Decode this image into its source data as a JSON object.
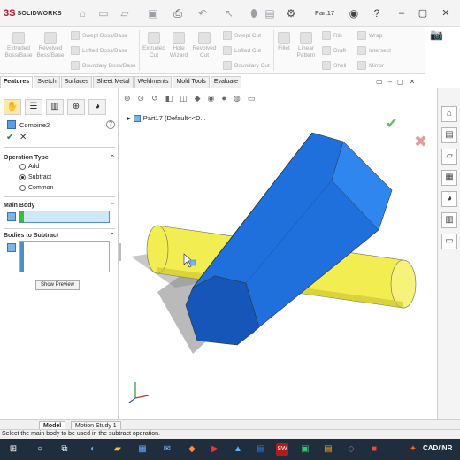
{
  "app": {
    "logo_text": "SOLIDWORKS",
    "doc_title": "Part17"
  },
  "ribbon": {
    "extruded_boss": "Extruded\nBoss/Base",
    "revolved_boss": "Revolved\nBoss/Base",
    "swept_boss": "Swept Boss/Base",
    "lofted_boss": "Lofted Boss/Base",
    "boundary_boss": "Boundary Boss/Base",
    "extruded_cut": "Extruded\nCut",
    "hole_wizard": "Hole\nWizard",
    "revolved_cut": "Revolved\nCut",
    "swept_cut": "Swept Cut",
    "lofted_cut": "Lofted Cut",
    "boundary_cut": "Boundary Cut",
    "fillet": "Fillet",
    "linear_pattern": "Linear\nPattern",
    "rib": "Rib",
    "draft": "Draft",
    "shell": "Shell",
    "wrap": "Wrap",
    "intersect": "Intersect",
    "mirror": "Mirror"
  },
  "tabs": [
    "Features",
    "Sketch",
    "Surfaces",
    "Sheet Metal",
    "Weldments",
    "Mold Tools",
    "Evaluate"
  ],
  "panel": {
    "feature_name": "Combine2",
    "operation_type": {
      "header": "Operation Type",
      "options": [
        "Add",
        "Subtract",
        "Common"
      ],
      "selected": "Subtract"
    },
    "main_body": {
      "header": "Main Body"
    },
    "bodies_to_subtract": {
      "header": "Bodies to Subtract"
    },
    "show_preview": "Show Preview"
  },
  "viewport": {
    "tree_label": "Part17  (Default<<D..."
  },
  "bottom_tabs": [
    "Model",
    "Motion Study 1"
  ],
  "status": "Select the main body to be used in the subtract operation.",
  "taskbar": {
    "watermark": "CAD/INR"
  },
  "colors": {
    "hex_prism": "#1f6fdc",
    "hex_prism_top": "#2f86ef",
    "hex_prism_shadow": "#1556b8",
    "cylinder": "#f2ee52",
    "cylinder_dark": "#c9c22e",
    "shadow": "#8c8c8c",
    "accent_green": "#32c232"
  }
}
